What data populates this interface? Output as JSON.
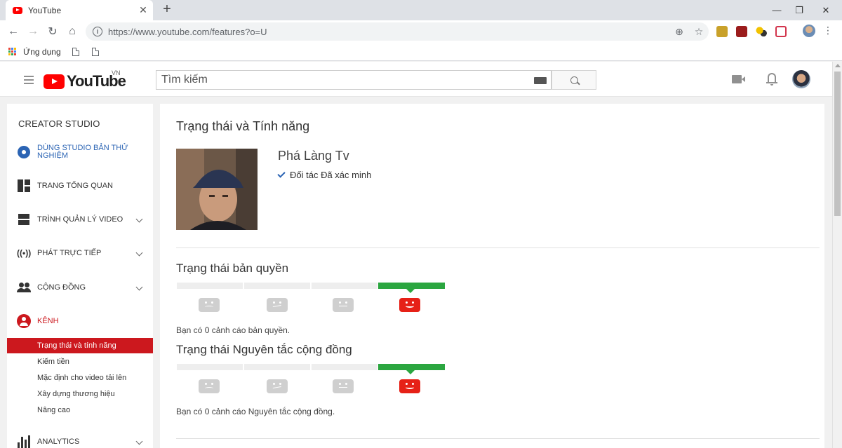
{
  "browser": {
    "tab_title": "YouTube",
    "tab_close": "✕",
    "new_tab": "+",
    "url": "https://www.youtube.com/features?o=U",
    "bookmark_apps_label": "Ứng dụng",
    "window_controls": [
      "—",
      "❐",
      "✕"
    ]
  },
  "header": {
    "logo_word": "YouTube",
    "country_code": "VN",
    "search_placeholder": "Tìm kiếm"
  },
  "sidebar": {
    "title": "CREATOR STUDIO",
    "items": [
      {
        "label": "DÙNG STUDIO BẢN THỬ NGHIỆM",
        "icon": "gear-icon"
      },
      {
        "label": "TRANG TỔNG QUAN",
        "icon": "dashboard-icon"
      },
      {
        "label": "TRÌNH QUẢN LÝ VIDEO",
        "icon": "video-manager-icon"
      },
      {
        "label": "PHÁT TRỰC TIẾP",
        "icon": "live-icon"
      },
      {
        "label": "CỘNG ĐỒNG",
        "icon": "community-icon"
      },
      {
        "label": "KÊNH",
        "icon": "channel-icon"
      },
      {
        "label": "ANALYTICS",
        "icon": "analytics-icon"
      }
    ],
    "channel_subitems": [
      "Trạng thái và tính năng",
      "Kiếm tiền",
      "Mặc định cho video tải lên",
      "Xây dựng thương hiệu",
      "Nâng cao"
    ],
    "active_subitem": 0
  },
  "main": {
    "title": "Trạng thái và Tính năng",
    "channel_name": "Phá Làng Tv",
    "verified_text": "Đối tác Đã xác minh",
    "copyright": {
      "title": "Trạng thái bản quyền",
      "note": "Bạn có 0 cảnh cáo bản quyền.",
      "current_level": 4,
      "levels": 4
    },
    "guidelines": {
      "title": "Trạng thái Nguyên tắc cộng đồng",
      "note": "Bạn có 0 cảnh cáo Nguyên tắc cộng đồng.",
      "current_level": 4,
      "levels": 4
    }
  },
  "colors": {
    "brand_red": "#ff0000",
    "active_red": "#cc181e",
    "good_green": "#2ba640",
    "link_blue": "#2b64b4"
  }
}
